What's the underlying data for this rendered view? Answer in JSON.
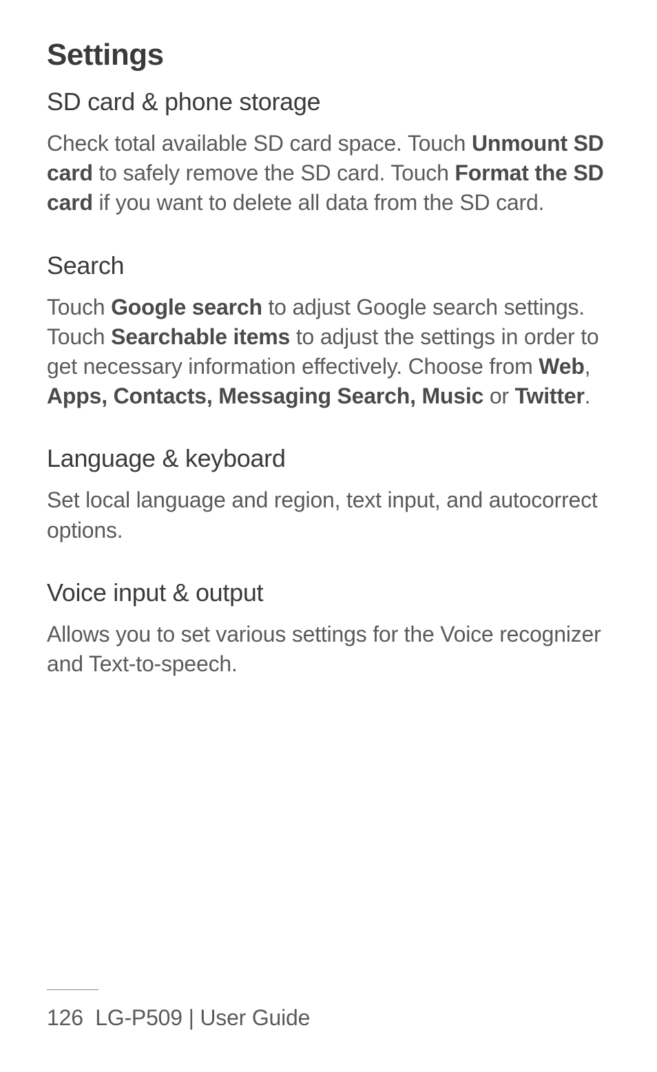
{
  "page_title": "Settings",
  "sections": {
    "sd_card": {
      "title": "SD card & phone storage",
      "p1_a": "Check total available SD card space. Touch ",
      "p1_b": "Unmount SD card",
      "p1_c": " to safely remove the SD card. Touch ",
      "p1_d": "Format the SD card",
      "p1_e": " if you want to delete all data from the SD card."
    },
    "search": {
      "title": "Search",
      "p1_a": "Touch ",
      "p1_b": "Google search",
      "p1_c": " to adjust Google search settings.",
      "p2_a": "Touch ",
      "p2_b": "Searchable items",
      "p2_c": " to adjust the settings in order to get necessary information effectively. Choose from ",
      "p2_d": "Web",
      "p2_e": ", ",
      "p2_f": "Apps, Contacts, Messaging Search, Music",
      "p2_g": " or ",
      "p2_h": "Twitter",
      "p2_i": "."
    },
    "language": {
      "title": "Language & keyboard",
      "body": "Set local language and region, text input, and autocorrect options."
    },
    "voice": {
      "title": "Voice input & output",
      "body": "Allows you to set various settings for the Voice recognizer and Text-to-speech."
    }
  },
  "footer": {
    "page_number": "126",
    "product": "LG-P509",
    "separator": "  |  ",
    "guide": "User Guide"
  }
}
